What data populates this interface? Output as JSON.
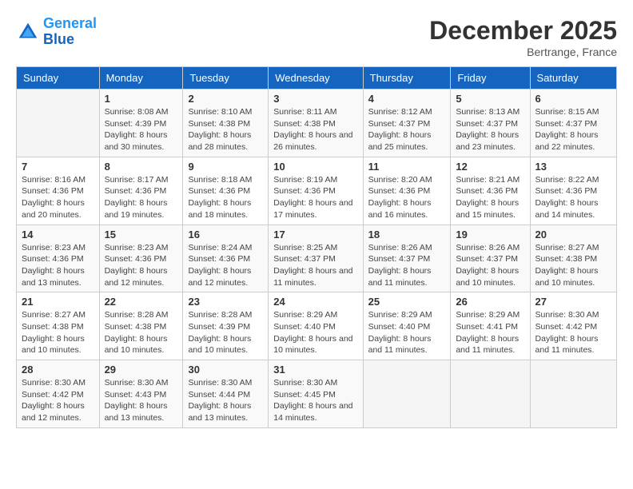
{
  "header": {
    "logo_line1": "General",
    "logo_line2": "Blue",
    "month_title": "December 2025",
    "location": "Bertrange, France"
  },
  "calendar": {
    "days_of_week": [
      "Sunday",
      "Monday",
      "Tuesday",
      "Wednesday",
      "Thursday",
      "Friday",
      "Saturday"
    ],
    "weeks": [
      [
        {
          "day": "",
          "sunrise": "",
          "sunset": "",
          "daylight": "",
          "empty": true
        },
        {
          "day": "1",
          "sunrise": "Sunrise: 8:08 AM",
          "sunset": "Sunset: 4:39 PM",
          "daylight": "Daylight: 8 hours and 30 minutes."
        },
        {
          "day": "2",
          "sunrise": "Sunrise: 8:10 AM",
          "sunset": "Sunset: 4:38 PM",
          "daylight": "Daylight: 8 hours and 28 minutes."
        },
        {
          "day": "3",
          "sunrise": "Sunrise: 8:11 AM",
          "sunset": "Sunset: 4:38 PM",
          "daylight": "Daylight: 8 hours and 26 minutes."
        },
        {
          "day": "4",
          "sunrise": "Sunrise: 8:12 AM",
          "sunset": "Sunset: 4:37 PM",
          "daylight": "Daylight: 8 hours and 25 minutes."
        },
        {
          "day": "5",
          "sunrise": "Sunrise: 8:13 AM",
          "sunset": "Sunset: 4:37 PM",
          "daylight": "Daylight: 8 hours and 23 minutes."
        },
        {
          "day": "6",
          "sunrise": "Sunrise: 8:15 AM",
          "sunset": "Sunset: 4:37 PM",
          "daylight": "Daylight: 8 hours and 22 minutes."
        }
      ],
      [
        {
          "day": "7",
          "sunrise": "Sunrise: 8:16 AM",
          "sunset": "Sunset: 4:36 PM",
          "daylight": "Daylight: 8 hours and 20 minutes."
        },
        {
          "day": "8",
          "sunrise": "Sunrise: 8:17 AM",
          "sunset": "Sunset: 4:36 PM",
          "daylight": "Daylight: 8 hours and 19 minutes."
        },
        {
          "day": "9",
          "sunrise": "Sunrise: 8:18 AM",
          "sunset": "Sunset: 4:36 PM",
          "daylight": "Daylight: 8 hours and 18 minutes."
        },
        {
          "day": "10",
          "sunrise": "Sunrise: 8:19 AM",
          "sunset": "Sunset: 4:36 PM",
          "daylight": "Daylight: 8 hours and 17 minutes."
        },
        {
          "day": "11",
          "sunrise": "Sunrise: 8:20 AM",
          "sunset": "Sunset: 4:36 PM",
          "daylight": "Daylight: 8 hours and 16 minutes."
        },
        {
          "day": "12",
          "sunrise": "Sunrise: 8:21 AM",
          "sunset": "Sunset: 4:36 PM",
          "daylight": "Daylight: 8 hours and 15 minutes."
        },
        {
          "day": "13",
          "sunrise": "Sunrise: 8:22 AM",
          "sunset": "Sunset: 4:36 PM",
          "daylight": "Daylight: 8 hours and 14 minutes."
        }
      ],
      [
        {
          "day": "14",
          "sunrise": "Sunrise: 8:23 AM",
          "sunset": "Sunset: 4:36 PM",
          "daylight": "Daylight: 8 hours and 13 minutes."
        },
        {
          "day": "15",
          "sunrise": "Sunrise: 8:23 AM",
          "sunset": "Sunset: 4:36 PM",
          "daylight": "Daylight: 8 hours and 12 minutes."
        },
        {
          "day": "16",
          "sunrise": "Sunrise: 8:24 AM",
          "sunset": "Sunset: 4:36 PM",
          "daylight": "Daylight: 8 hours and 12 minutes."
        },
        {
          "day": "17",
          "sunrise": "Sunrise: 8:25 AM",
          "sunset": "Sunset: 4:37 PM",
          "daylight": "Daylight: 8 hours and 11 minutes."
        },
        {
          "day": "18",
          "sunrise": "Sunrise: 8:26 AM",
          "sunset": "Sunset: 4:37 PM",
          "daylight": "Daylight: 8 hours and 11 minutes."
        },
        {
          "day": "19",
          "sunrise": "Sunrise: 8:26 AM",
          "sunset": "Sunset: 4:37 PM",
          "daylight": "Daylight: 8 hours and 10 minutes."
        },
        {
          "day": "20",
          "sunrise": "Sunrise: 8:27 AM",
          "sunset": "Sunset: 4:38 PM",
          "daylight": "Daylight: 8 hours and 10 minutes."
        }
      ],
      [
        {
          "day": "21",
          "sunrise": "Sunrise: 8:27 AM",
          "sunset": "Sunset: 4:38 PM",
          "daylight": "Daylight: 8 hours and 10 minutes."
        },
        {
          "day": "22",
          "sunrise": "Sunrise: 8:28 AM",
          "sunset": "Sunset: 4:38 PM",
          "daylight": "Daylight: 8 hours and 10 minutes."
        },
        {
          "day": "23",
          "sunrise": "Sunrise: 8:28 AM",
          "sunset": "Sunset: 4:39 PM",
          "daylight": "Daylight: 8 hours and 10 minutes."
        },
        {
          "day": "24",
          "sunrise": "Sunrise: 8:29 AM",
          "sunset": "Sunset: 4:40 PM",
          "daylight": "Daylight: 8 hours and 10 minutes."
        },
        {
          "day": "25",
          "sunrise": "Sunrise: 8:29 AM",
          "sunset": "Sunset: 4:40 PM",
          "daylight": "Daylight: 8 hours and 11 minutes."
        },
        {
          "day": "26",
          "sunrise": "Sunrise: 8:29 AM",
          "sunset": "Sunset: 4:41 PM",
          "daylight": "Daylight: 8 hours and 11 minutes."
        },
        {
          "day": "27",
          "sunrise": "Sunrise: 8:30 AM",
          "sunset": "Sunset: 4:42 PM",
          "daylight": "Daylight: 8 hours and 11 minutes."
        }
      ],
      [
        {
          "day": "28",
          "sunrise": "Sunrise: 8:30 AM",
          "sunset": "Sunset: 4:42 PM",
          "daylight": "Daylight: 8 hours and 12 minutes."
        },
        {
          "day": "29",
          "sunrise": "Sunrise: 8:30 AM",
          "sunset": "Sunset: 4:43 PM",
          "daylight": "Daylight: 8 hours and 13 minutes."
        },
        {
          "day": "30",
          "sunrise": "Sunrise: 8:30 AM",
          "sunset": "Sunset: 4:44 PM",
          "daylight": "Daylight: 8 hours and 13 minutes."
        },
        {
          "day": "31",
          "sunrise": "Sunrise: 8:30 AM",
          "sunset": "Sunset: 4:45 PM",
          "daylight": "Daylight: 8 hours and 14 minutes."
        },
        {
          "day": "",
          "sunrise": "",
          "sunset": "",
          "daylight": "",
          "empty": true
        },
        {
          "day": "",
          "sunrise": "",
          "sunset": "",
          "daylight": "",
          "empty": true
        },
        {
          "day": "",
          "sunrise": "",
          "sunset": "",
          "daylight": "",
          "empty": true
        }
      ]
    ]
  }
}
